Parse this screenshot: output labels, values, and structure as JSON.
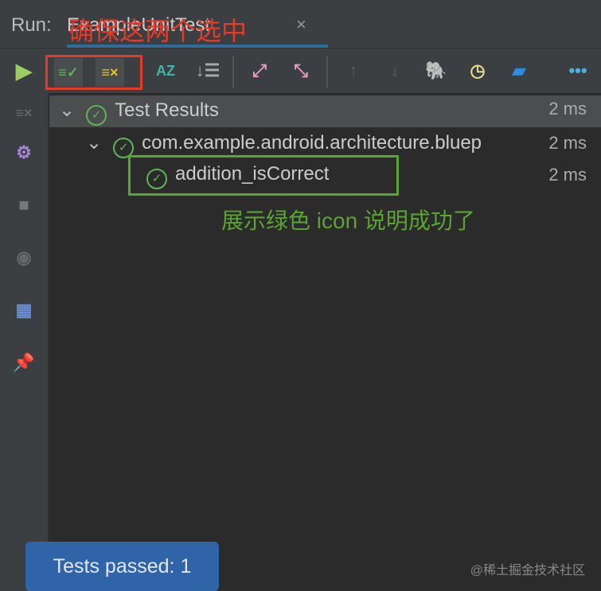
{
  "header": {
    "run_label": "Run:",
    "tab_label": "ExampleUnitTest",
    "close": "×"
  },
  "annotations": {
    "top": "确保这两个选中",
    "middle": "展示绿色 icon 说明成功了"
  },
  "tree": [
    {
      "label": "Test Results",
      "time": "2 ms"
    },
    {
      "label": "com.example.android.architecture.bluep",
      "time": "2 ms"
    },
    {
      "label": "addition_isCorrect",
      "time": "2 ms"
    }
  ],
  "status": {
    "badge": "Tests passed: 1"
  },
  "watermark": "@稀土掘金技术社区"
}
